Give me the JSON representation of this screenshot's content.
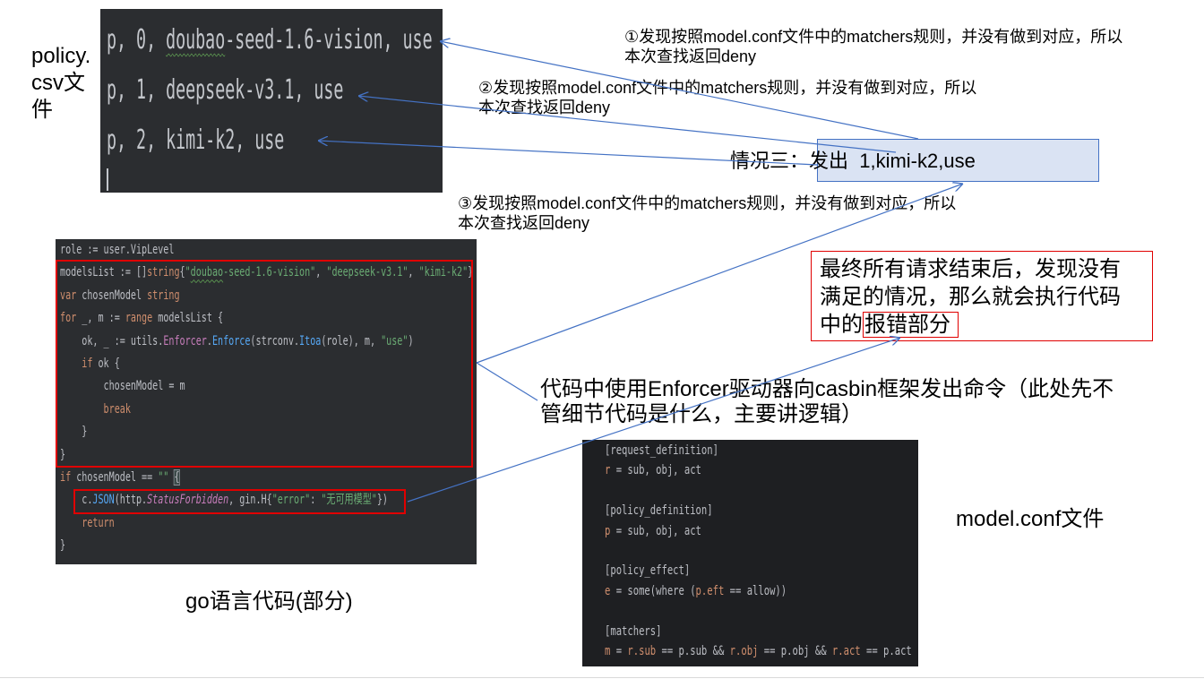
{
  "colors": {
    "arrow_blue": "#4472c4",
    "highlight_red": "#e00000",
    "request_box_fill": "#dae3f3"
  },
  "policy_csv": {
    "label": "policy.\ncsv文\n件",
    "lines": [
      [
        {
          "plain": "p, 0, "
        },
        {
          "plain_squiggle": "doubao"
        },
        {
          "plain": "-seed-1.6-vision, use"
        }
      ],
      [
        {
          "plain": "p, 1, deepseek-v3.1, use"
        }
      ],
      [
        {
          "plain": "p, 2, kimi-k2, use"
        }
      ]
    ]
  },
  "annotations": {
    "step1": "①发现按照model.conf文件中的matchers规则，并没有做到对应，所以\n本次查找返回deny",
    "step2": "②发现按照model.conf文件中的matchers规则，并没有做到对应，所以\n本次查找返回deny",
    "step3": "③发现按照model.conf文件中的matchers规则，并没有做到对应，所以\n本次查找返回deny",
    "request": "情况三：发出  1,kimi-k2,use",
    "conclusion": "最终所有请求结束后，发现没有\n满足的情况，那么就会执行代码\n中的",
    "conclusion_highlight": "报错部分",
    "enforcer_note": "代码中使用Enforcer驱动器向casbin框架发出命令（此处先不\n管细节代码是什么，主要讲逻辑）"
  },
  "go_code": {
    "caption": "go语言代码(部分)",
    "lines": [
      [
        {
          "plain": "role := user.VipLevel"
        }
      ],
      [
        {
          "plain": "modelsList := []"
        },
        {
          "kw": "string"
        },
        {
          "plain": "{"
        },
        {
          "str": "\""
        },
        {
          "str_squiggle": "doubao"
        },
        {
          "str": "-seed-1.6-vision\""
        },
        {
          "plain": ", "
        },
        {
          "str": "\"deepseek-v3.1\""
        },
        {
          "plain": ", "
        },
        {
          "str": "\"kimi-k2\""
        },
        {
          "plain": "}"
        }
      ],
      [
        {
          "kw": "var"
        },
        {
          "plain": " chosenModel "
        },
        {
          "kw": "string"
        }
      ],
      [
        {
          "kw": "for"
        },
        {
          "plain": " _, m := "
        },
        {
          "kw": "range"
        },
        {
          "plain": " modelsList {"
        }
      ],
      [
        {
          "plain": "    ok, _ := utils."
        },
        {
          "field": "Enforcer"
        },
        {
          "plain": "."
        },
        {
          "fn": "Enforce"
        },
        {
          "plain": "(strconv."
        },
        {
          "fn": "Itoa"
        },
        {
          "plain": "(role), m, "
        },
        {
          "str": "\"use\""
        },
        {
          "plain": ")"
        }
      ],
      [
        {
          "plain": "    "
        },
        {
          "kw": "if"
        },
        {
          "plain": " ok {"
        }
      ],
      [
        {
          "plain": "        chosenModel = m"
        }
      ],
      [
        {
          "plain": "        "
        },
        {
          "kw": "break"
        }
      ],
      [
        {
          "plain": "    }"
        }
      ],
      [
        {
          "plain": "}"
        }
      ],
      [
        {
          "kw": "if"
        },
        {
          "plain": " chosenModel == "
        },
        {
          "str": "\"\""
        },
        {
          "plain": " "
        },
        {
          "plain_brace": "{"
        }
      ],
      [
        {
          "plain": "    c."
        },
        {
          "fn": "JSON"
        },
        {
          "plain": "(http."
        },
        {
          "const": "StatusForbidden"
        },
        {
          "plain": ", gin.H{"
        },
        {
          "str": "\"error\""
        },
        {
          "plain": ": "
        },
        {
          "str": "\"无可用模型\""
        },
        {
          "plain": "})"
        }
      ],
      [
        {
          "plain": "    "
        },
        {
          "kw": "return"
        }
      ],
      [
        {
          "plain": "}"
        }
      ]
    ]
  },
  "model_conf": {
    "caption": "model.conf文件",
    "lines": [
      [
        {
          "plain": "[request_definition]"
        }
      ],
      [
        {
          "var": "r"
        },
        {
          "plain": " = sub, obj, act"
        }
      ],
      [],
      [
        {
          "plain": "[policy_definition]"
        }
      ],
      [
        {
          "var": "p"
        },
        {
          "plain": " = sub, obj, act"
        }
      ],
      [],
      [
        {
          "plain": "[policy_effect]"
        }
      ],
      [
        {
          "var": "e"
        },
        {
          "plain": " = some(where ("
        },
        {
          "var": "p.eft"
        },
        {
          "plain": " == allow))"
        }
      ],
      [],
      [
        {
          "plain": "[matchers]"
        }
      ],
      [
        {
          "var": "m"
        },
        {
          "plain": " = "
        },
        {
          "var": "r.sub"
        },
        {
          "plain": " == p.sub && "
        },
        {
          "var": "r.obj"
        },
        {
          "plain": " == p.obj && "
        },
        {
          "var": "r.act"
        },
        {
          "plain": " == p.act"
        }
      ]
    ]
  }
}
